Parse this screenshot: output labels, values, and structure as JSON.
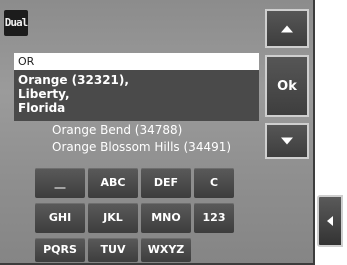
{
  "brand": {
    "logo_text": "Dual"
  },
  "search": {
    "value": "OR"
  },
  "results": {
    "selected": "Orange (32321),\nLiberty,\nFlorida",
    "items": [
      "Orange Bend (34788)",
      "Orange Blossom Hills (34491)"
    ]
  },
  "side": {
    "up_icon": "up-arrow-icon",
    "ok_label": "Ok",
    "down_icon": "down-arrow-icon",
    "back_icon": "left-arrow-icon"
  },
  "keyboard": {
    "row1": [
      "__",
      "ABC",
      "DEF",
      "C"
    ],
    "row2": [
      "GHI",
      "JKL",
      "MNO",
      "123"
    ],
    "row3": [
      "PQRS",
      "TUV",
      "WXYZ"
    ]
  }
}
